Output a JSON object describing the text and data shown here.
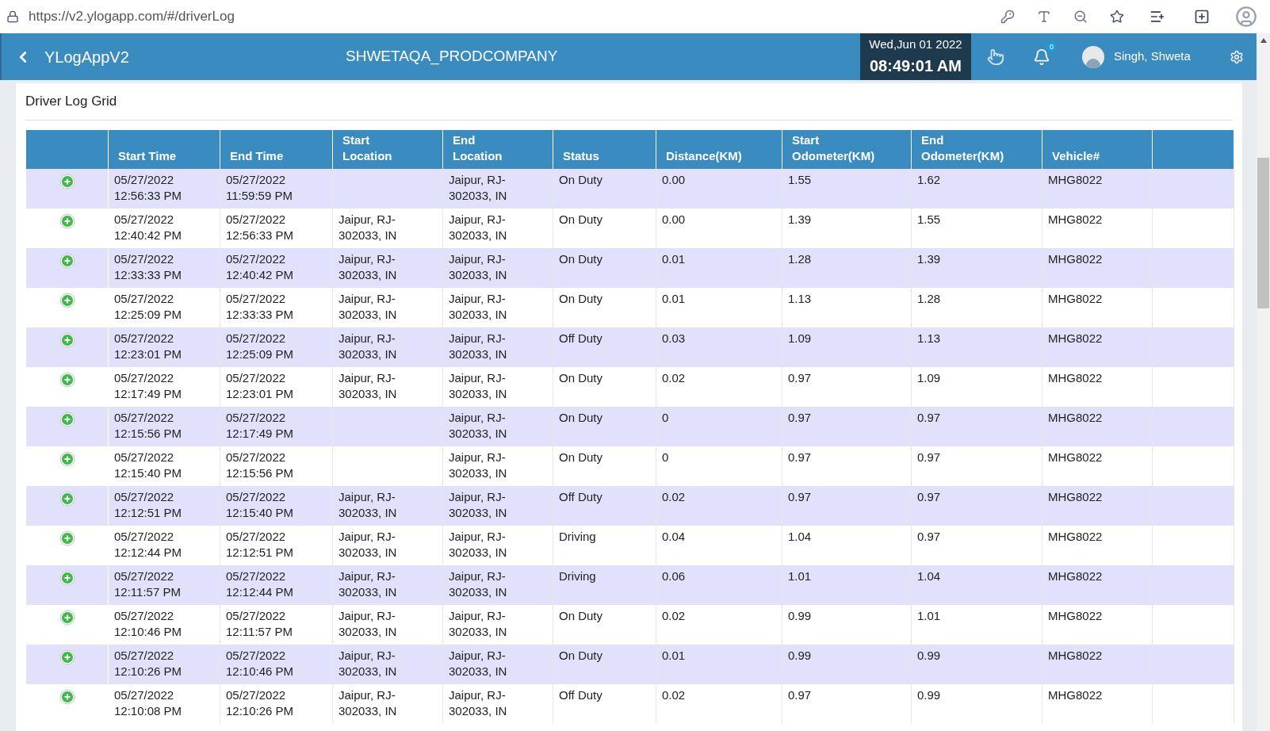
{
  "browser": {
    "url": "https://v2.ylogapp.com/#/driverLog"
  },
  "header": {
    "app_name": "YLogAppV2",
    "company": "SHWETAQA_PRODCOMPANY",
    "date": "Wed,Jun 01 2022",
    "time": "08:49:01 AM",
    "notification_count": "0",
    "user": "Singh, Shweta"
  },
  "card": {
    "title": "Driver Log Grid"
  },
  "table": {
    "columns": [
      "Start Time",
      "End Time",
      "Start Location",
      "End Location",
      "Status",
      "Distance(KM)",
      "Start Odometer(KM)",
      "End Odometer(KM)",
      "Vehicle#"
    ],
    "rows": [
      [
        "05/27/2022 12:56:33 PM",
        "05/27/2022 11:59:59 PM",
        "",
        "Jaipur, RJ-302033, IN",
        "On Duty",
        "0.00",
        "1.55",
        "1.62",
        "MHG8022"
      ],
      [
        "05/27/2022 12:40:42 PM",
        "05/27/2022 12:56:33 PM",
        "Jaipur, RJ-302033, IN",
        "Jaipur, RJ-302033, IN",
        "On Duty",
        "0.00",
        "1.39",
        "1.55",
        "MHG8022"
      ],
      [
        "05/27/2022 12:33:33 PM",
        "05/27/2022 12:40:42 PM",
        "Jaipur, RJ-302033, IN",
        "Jaipur, RJ-302033, IN",
        "On Duty",
        "0.01",
        "1.28",
        "1.39",
        "MHG8022"
      ],
      [
        "05/27/2022 12:25:09 PM",
        "05/27/2022 12:33:33 PM",
        "Jaipur, RJ-302033, IN",
        "Jaipur, RJ-302033, IN",
        "On Duty",
        "0.01",
        "1.13",
        "1.28",
        "MHG8022"
      ],
      [
        "05/27/2022 12:23:01 PM",
        "05/27/2022 12:25:09 PM",
        "Jaipur, RJ-302033, IN",
        "Jaipur, RJ-302033, IN",
        "Off Duty",
        "0.03",
        "1.09",
        "1.13",
        "MHG8022"
      ],
      [
        "05/27/2022 12:17:49 PM",
        "05/27/2022 12:23:01 PM",
        "Jaipur, RJ-302033, IN",
        "Jaipur, RJ-302033, IN",
        "On Duty",
        "0.02",
        "0.97",
        "1.09",
        "MHG8022"
      ],
      [
        "05/27/2022 12:15:56 PM",
        "05/27/2022 12:17:49 PM",
        "",
        "Jaipur, RJ-302033, IN",
        "On Duty",
        "0",
        "0.97",
        "0.97",
        "MHG8022"
      ],
      [
        "05/27/2022 12:15:40 PM",
        "05/27/2022 12:15:56 PM",
        "",
        "Jaipur, RJ-302033, IN",
        "On Duty",
        "0",
        "0.97",
        "0.97",
        "MHG8022"
      ],
      [
        "05/27/2022 12:12:51 PM",
        "05/27/2022 12:15:40 PM",
        "Jaipur, RJ-302033, IN",
        "Jaipur, RJ-302033, IN",
        "Off Duty",
        "0.02",
        "0.97",
        "0.97",
        "MHG8022"
      ],
      [
        "05/27/2022 12:12:44 PM",
        "05/27/2022 12:12:51 PM",
        "Jaipur, RJ-302033, IN",
        "Jaipur, RJ-302033, IN",
        "Driving",
        "0.04",
        "1.04",
        "0.97",
        "MHG8022"
      ],
      [
        "05/27/2022 12:11:57 PM",
        "05/27/2022 12:12:44 PM",
        "Jaipur, RJ-302033, IN",
        "Jaipur, RJ-302033, IN",
        "Driving",
        "0.06",
        "1.01",
        "1.04",
        "MHG8022"
      ],
      [
        "05/27/2022 12:10:46 PM",
        "05/27/2022 12:11:57 PM",
        "Jaipur, RJ-302033, IN",
        "Jaipur, RJ-302033, IN",
        "On Duty",
        "0.02",
        "0.99",
        "1.01",
        "MHG8022"
      ],
      [
        "05/27/2022 12:10:26 PM",
        "05/27/2022 12:10:46 PM",
        "Jaipur, RJ-302033, IN",
        "Jaipur, RJ-302033, IN",
        "On Duty",
        "0.01",
        "0.99",
        "0.99",
        "MHG8022"
      ],
      [
        "05/27/2022 12:10:08 PM",
        "05/27/2022 12:10:26 PM",
        "Jaipur, RJ-302033, IN",
        "Jaipur, RJ-302033, IN",
        "Off Duty",
        "0.02",
        "0.97",
        "0.99",
        "MHG8022"
      ]
    ]
  }
}
